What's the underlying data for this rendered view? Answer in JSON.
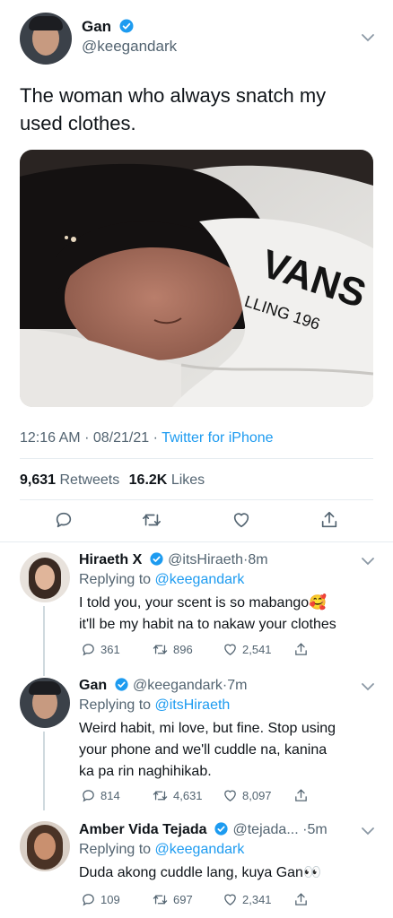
{
  "tweet": {
    "author_name": "Gan",
    "author_handle": "@keegandark",
    "text": "The woman who always snatch my used clothes.",
    "time": "12:16 AM",
    "date": "08/21/21",
    "separator": "·",
    "source": "Twitter for iPhone",
    "retweets_count": "9,631",
    "retweets_label": "Retweets",
    "likes_count": "16.2K",
    "likes_label": "Likes",
    "photo_shirt_text": "VANS",
    "photo_shirt_sub": "LLING 196"
  },
  "icons": {
    "verified": "verified-badge-icon",
    "chevron": "chevron-down-icon",
    "reply": "reply-icon",
    "retweet": "retweet-icon",
    "like": "heart-icon",
    "share": "share-icon"
  },
  "colors": {
    "accent": "#1d9bf0",
    "muted": "#536471",
    "divider": "#e6ecf0"
  },
  "replies": [
    {
      "name": "Hiraeth X",
      "handle": "@itsHiraeth",
      "time": "8m",
      "replying_label": "Replying to",
      "replying_to": "@keegandark",
      "text_line1": "I told you, your scent is so mabango🥰",
      "text_line2": "it'll be my habit na to nakaw your clothes",
      "replies": "361",
      "retweets": "896",
      "likes": "2,541"
    },
    {
      "name": "Gan",
      "handle": "@keegandark",
      "time": "7m",
      "replying_label": "Replying to",
      "replying_to": "@itsHiraeth",
      "text_line1": "Weird habit, mi love, but fine. Stop using",
      "text_line2": "your phone and we'll cuddle na, kanina",
      "text_line3": "ka pa rin naghihikab.",
      "replies": "814",
      "retweets": "4,631",
      "likes": "8,097"
    },
    {
      "name": "Amber Vida Tejada",
      "handle": "@tejada...",
      "time": "5m",
      "replying_label": "Replying to",
      "replying_to": "@keegandark",
      "text_line1": "Duda akong cuddle lang, kuya Gan👀",
      "replies": "109",
      "retweets": "697",
      "likes": "2,341"
    }
  ]
}
